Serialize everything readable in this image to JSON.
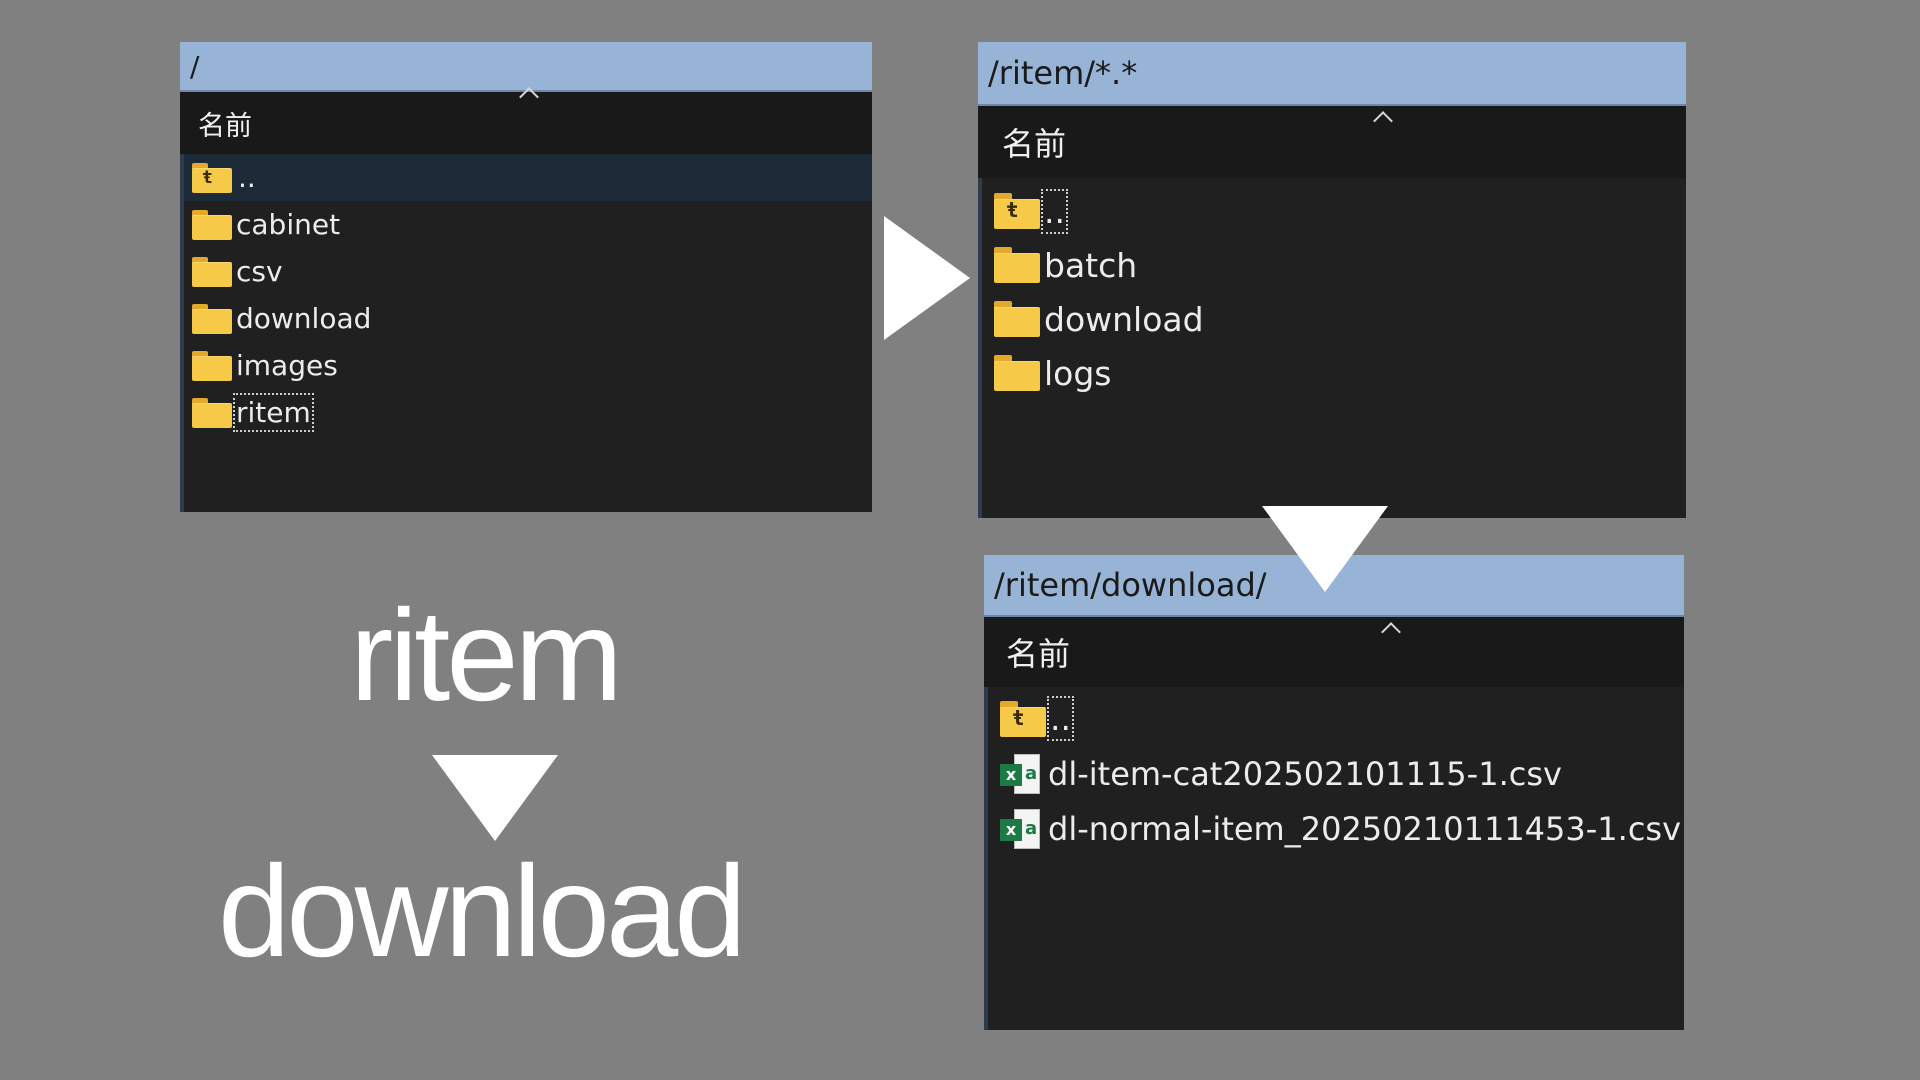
{
  "panel_root": {
    "path": "/",
    "column_header": "名前",
    "items": [
      {
        "name": "..",
        "type": "parent"
      },
      {
        "name": "cabinet",
        "type": "folder"
      },
      {
        "name": "csv",
        "type": "folder"
      },
      {
        "name": "download",
        "type": "folder"
      },
      {
        "name": "images",
        "type": "folder"
      },
      {
        "name": "ritem",
        "type": "folder"
      }
    ]
  },
  "panel_ritem": {
    "path": "/ritem/*.*",
    "column_header": "名前",
    "items": [
      {
        "name": "..",
        "type": "parent"
      },
      {
        "name": "batch",
        "type": "folder"
      },
      {
        "name": "download",
        "type": "folder"
      },
      {
        "name": "logs",
        "type": "folder"
      }
    ]
  },
  "panel_download": {
    "path": "/ritem/download/",
    "column_header": "名前",
    "items": [
      {
        "name": "..",
        "type": "parent"
      },
      {
        "name": "dl-item-cat202502101115-1.csv",
        "type": "excel"
      },
      {
        "name": "dl-normal-item_20250210111453-1.csv",
        "type": "excel"
      }
    ]
  },
  "caption": {
    "from": "ritem",
    "to": "download"
  },
  "icons": {
    "folder": "folder-icon",
    "parent": "parent-folder-icon",
    "excel": "excel-file-icon",
    "arrow_right": "arrow-right-icon",
    "arrow_down": "arrow-down-icon"
  },
  "colors": {
    "background": "#808080",
    "path_bar": "#97b3d6",
    "list_bg": "#202020",
    "folder": "#f7c948",
    "excel_green": "#1d7a44"
  }
}
